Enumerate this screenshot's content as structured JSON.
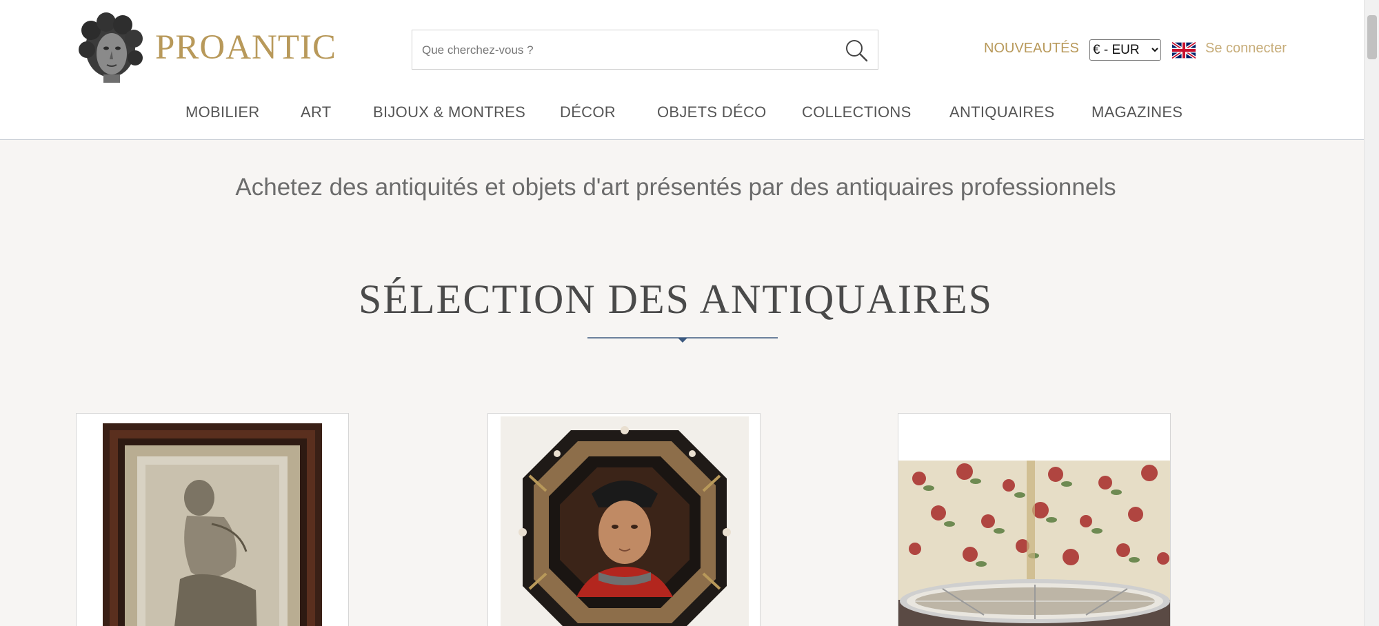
{
  "header": {
    "logo_text": "PROANTIC",
    "search_placeholder": "Que cherchez-vous ?",
    "nouveautes": "NOUVEAUTÉS",
    "currency": {
      "selected": "€ - EUR",
      "options": [
        "€ - EUR"
      ]
    },
    "login": "Se connecter"
  },
  "nav": {
    "items": [
      {
        "label": "MOBILIER"
      },
      {
        "label": "ART"
      },
      {
        "label": "BIJOUX & MONTRES"
      },
      {
        "label": "DÉCOR"
      },
      {
        "label": "OBJETS DÉCO"
      },
      {
        "label": "COLLECTIONS"
      },
      {
        "label": "ANTIQUAIRES"
      },
      {
        "label": "MAGAZINES"
      }
    ]
  },
  "main": {
    "tagline": "Achetez des antiquités et objets d'art présentés par des antiquaires professionnels",
    "section_title": "SÉLECTION DES ANTIQUAIRES",
    "products": [
      {
        "icon": "framed-drawing-image"
      },
      {
        "icon": "octagonal-portrait-image"
      },
      {
        "icon": "mirror-tray-image"
      }
    ]
  },
  "colors": {
    "gold": "#b8995a",
    "gold_light": "#c7ad7a",
    "nav_text": "#555555",
    "background": "#f7f5f3",
    "accent_line": "#3d5a80"
  }
}
